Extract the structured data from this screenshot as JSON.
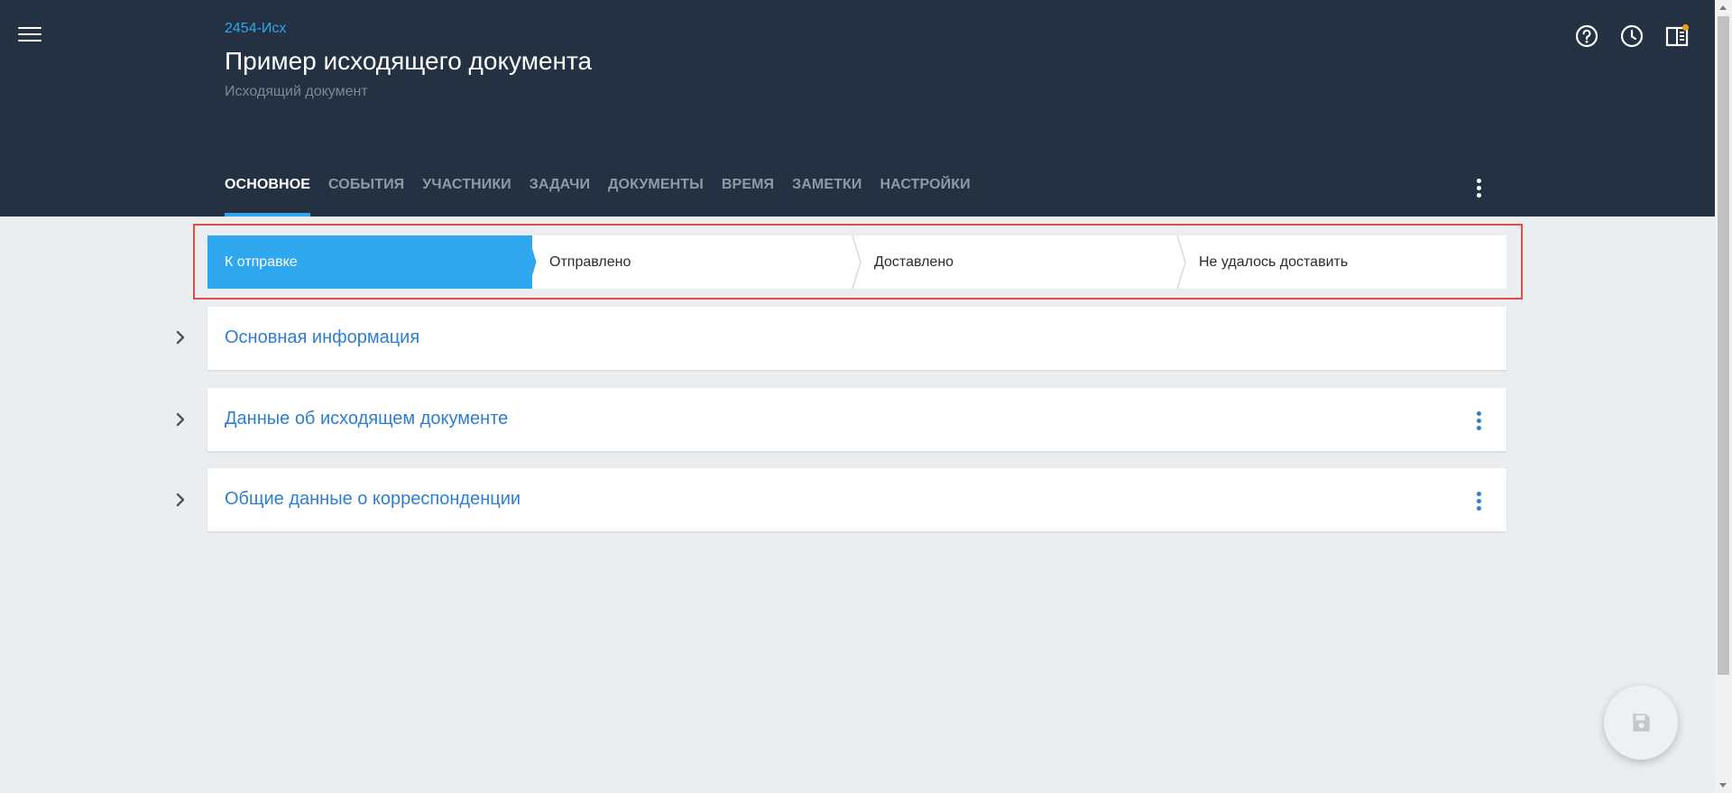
{
  "header": {
    "doc_number": "2454-Исх",
    "title": "Пример исходящего документа",
    "subtitle": "Исходящий документ",
    "background_color": "#243142",
    "accent_color": "#2ea7ef",
    "icons": [
      "menu-icon",
      "help-icon",
      "history-icon",
      "panel-icon"
    ]
  },
  "tabs": [
    {
      "label": "ОСНОВНОЕ",
      "active": true
    },
    {
      "label": "СОБЫТИЯ",
      "active": false
    },
    {
      "label": "УЧАСТНИКИ",
      "active": false
    },
    {
      "label": "ЗАДАЧИ",
      "active": false
    },
    {
      "label": "ДОКУМЕНТЫ",
      "active": false
    },
    {
      "label": "ВРЕМЯ",
      "active": false
    },
    {
      "label": "ЗАМЕТКИ",
      "active": false
    },
    {
      "label": "НАСТРОЙКИ",
      "active": false
    }
  ],
  "status_steps": [
    {
      "label": "К отправке",
      "active": true
    },
    {
      "label": "Отправлено",
      "active": false
    },
    {
      "label": "Доставлено",
      "active": false
    },
    {
      "label": "Не удалось доставить",
      "active": false
    }
  ],
  "sections": [
    {
      "title": "Основная информация",
      "has_menu": false
    },
    {
      "title": "Данные об исходящем документе",
      "has_menu": true
    },
    {
      "title": "Общие данные о корреспонденции",
      "has_menu": true
    }
  ],
  "fab": {
    "icon": "save-icon"
  },
  "colors": {
    "page_background": "#ebeef0",
    "link_blue": "#2f7fd0",
    "highlight_frame": "#e24b4b",
    "notification_dot": "#f39c12"
  }
}
